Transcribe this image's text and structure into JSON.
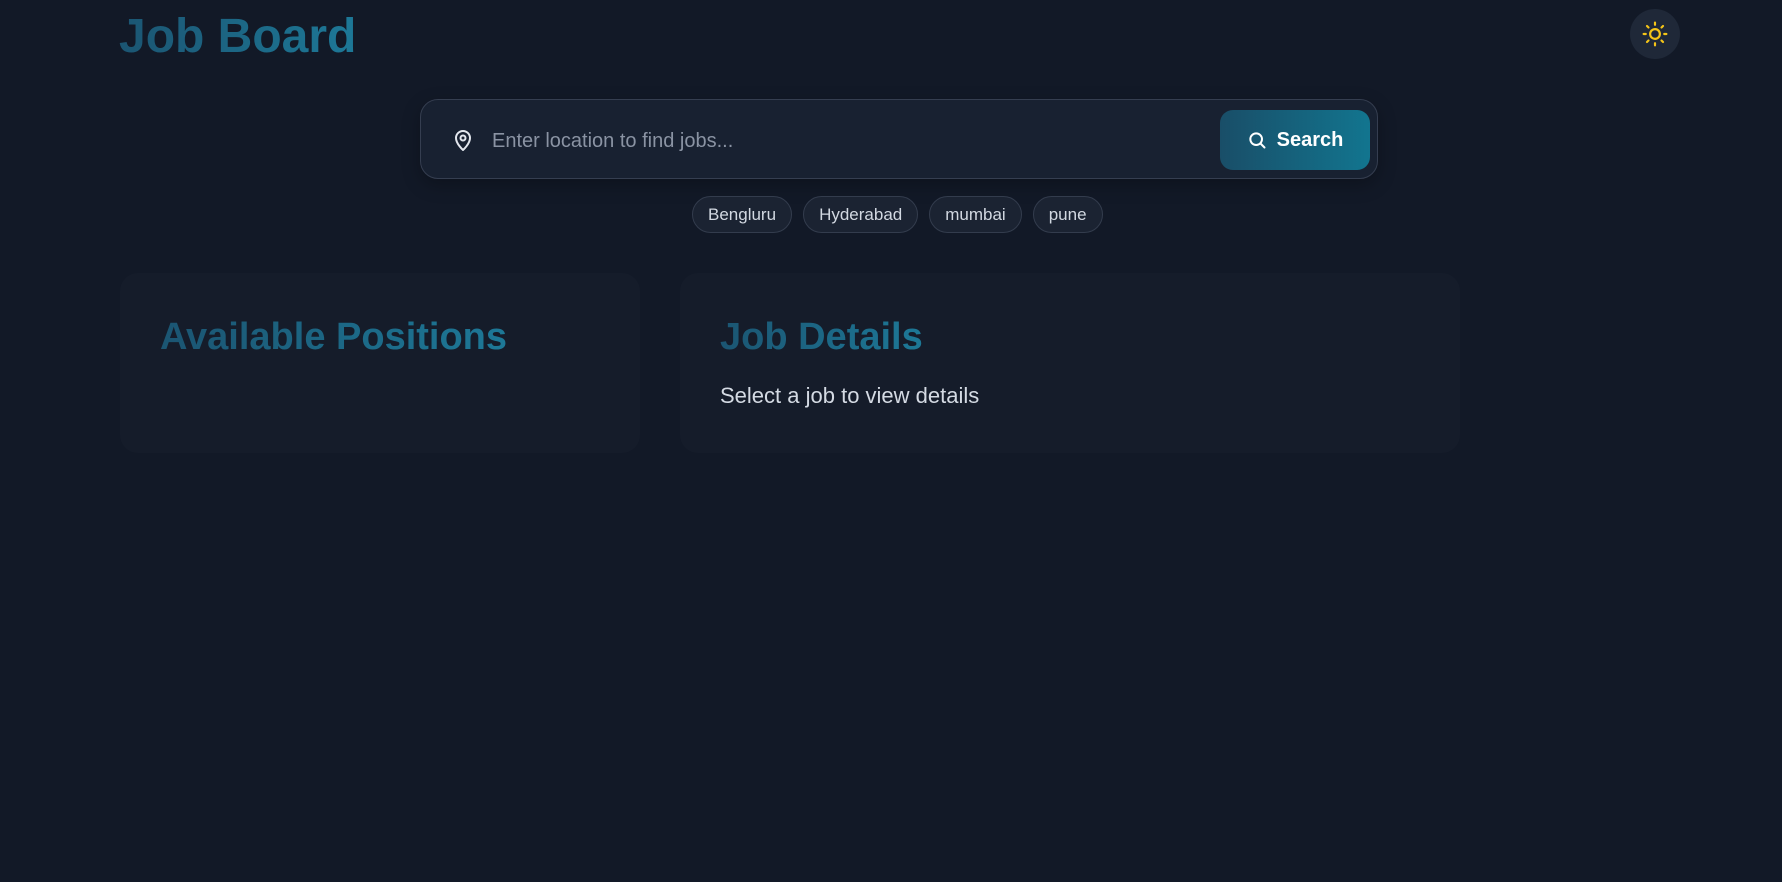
{
  "header": {
    "title": "Job Board",
    "theme_toggle_icon": "sun-icon"
  },
  "search": {
    "placeholder": "Enter location to find jobs...",
    "value": "",
    "location_icon": "map-pin-icon",
    "button_label": "Search",
    "button_icon": "search-icon"
  },
  "quick_locations": [
    {
      "label": "Bengluru"
    },
    {
      "label": "Hyderabad"
    },
    {
      "label": "mumbai"
    },
    {
      "label": "pune"
    }
  ],
  "positions_panel": {
    "heading": "Available Positions"
  },
  "details_panel": {
    "heading": "Job Details",
    "empty_text": "Select a job to view details"
  },
  "colors": {
    "background": "#121927",
    "accent": "#1d7897",
    "sun": "#f5c518"
  }
}
